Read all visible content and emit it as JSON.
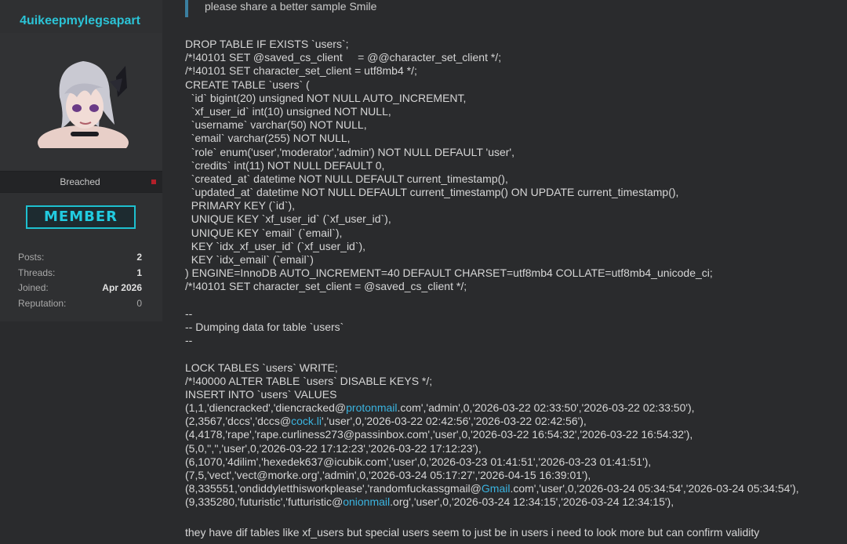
{
  "sidebar": {
    "username": "4uikeepmylegsapart",
    "rank": "Breached",
    "badge": "MEMBER",
    "stats": [
      {
        "label": "Posts:",
        "value": "2"
      },
      {
        "label": "Threads:",
        "value": "1"
      },
      {
        "label": "Joined:",
        "value": "Apr 2026"
      },
      {
        "label": "Reputation:",
        "value": "0"
      }
    ]
  },
  "post": {
    "quote": "please share a better sample Smile",
    "code_lines": [
      [
        "DROP TABLE IF EXISTS `users`;"
      ],
      [
        "/*!40101 SET @saved_cs_client     = @@character_set_client */;"
      ],
      [
        "/*!40101 SET character_set_client = utf8mb4 */;"
      ],
      [
        "CREATE TABLE `users` ("
      ],
      [
        "  `id` bigint(20) unsigned NOT NULL AUTO_INCREMENT,"
      ],
      [
        "  `xf_user_id` int(10) unsigned NOT NULL,"
      ],
      [
        "  `username` varchar(50) NOT NULL,"
      ],
      [
        "  `email` varchar(255) NOT NULL,"
      ],
      [
        "  `role` enum('user','moderator','admin') NOT NULL DEFAULT 'user',"
      ],
      [
        "  `credits` int(11) NOT NULL DEFAULT 0,"
      ],
      [
        "  `created_at` datetime NOT NULL DEFAULT current_timestamp(),"
      ],
      [
        "  `updated_at` datetime NOT NULL DEFAULT current_timestamp() ON UPDATE current_timestamp(),"
      ],
      [
        "  PRIMARY KEY (`id`),"
      ],
      [
        "  UNIQUE KEY `xf_user_id` (`xf_user_id`),"
      ],
      [
        "  UNIQUE KEY `email` (`email`),"
      ],
      [
        "  KEY `idx_xf_user_id` (`xf_user_id`),"
      ],
      [
        "  KEY `idx_email` (`email`)"
      ],
      [
        ") ENGINE=InnoDB AUTO_INCREMENT=40 DEFAULT CHARSET=utf8mb4 COLLATE=utf8mb4_unicode_ci;"
      ],
      [
        "/*!40101 SET character_set_client = @saved_cs_client */;"
      ],
      [
        ""
      ],
      [
        "--"
      ],
      [
        "-- Dumping data for table `users`"
      ],
      [
        "--"
      ],
      [
        ""
      ],
      [
        "LOCK TABLES `users` WRITE;"
      ],
      [
        "/*!40000 ALTER TABLE `users` DISABLE KEYS */;"
      ],
      [
        "INSERT INTO `users` VALUES"
      ],
      [
        "(1,1,'diencracked','diencracked@",
        "protonmail",
        ".com','admin',0,'2026-03-22 02:33:50','2026-03-22 02:33:50'),"
      ],
      [
        "(2,3567,'dccs','dccs@",
        "cock.li",
        "','user',0,'2026-03-22 02:42:56','2026-03-22 02:42:56'),"
      ],
      [
        "(4,4178,'rape','rape.curliness273@passinbox.com','user',0,'2026-03-22 16:54:32','2026-03-22 16:54:32'),"
      ],
      [
        "(5,0,'','','user',0,'2026-03-22 17:12:23','2026-03-22 17:12:23'),"
      ],
      [
        "(6,1070,'4dilim','hexedek637@icubik.com','user',0,'2026-03-23 01:41:51','2026-03-23 01:41:51'),"
      ],
      [
        "(7,5,'vect','vect@morke.org','admin',0,'2026-03-24 05:17:27','2026-04-15 16:39:01'),"
      ],
      [
        "(8,335551,'ondiddyletthisworkplease','randomfuckassgmail@",
        "Gmail",
        ".com','user',0,'2026-03-24 05:34:54','2026-03-24 05:34:54'),"
      ],
      [
        "(9,335280,'futuristic','futturistic@",
        "onionmail",
        ".org','user',0,'2026-03-24 12:34:15','2026-03-24 12:34:15'),"
      ]
    ],
    "footer": "they have dif tables like xf_users but special users seem to just be in users i need to look more but can confirm validity"
  },
  "colors": {
    "background": "#2a2b2d",
    "sidebar": "#2f3032",
    "accent_cyan": "#22cbe0",
    "link": "#3bb4e0",
    "rank_dot": "#b3202a"
  }
}
